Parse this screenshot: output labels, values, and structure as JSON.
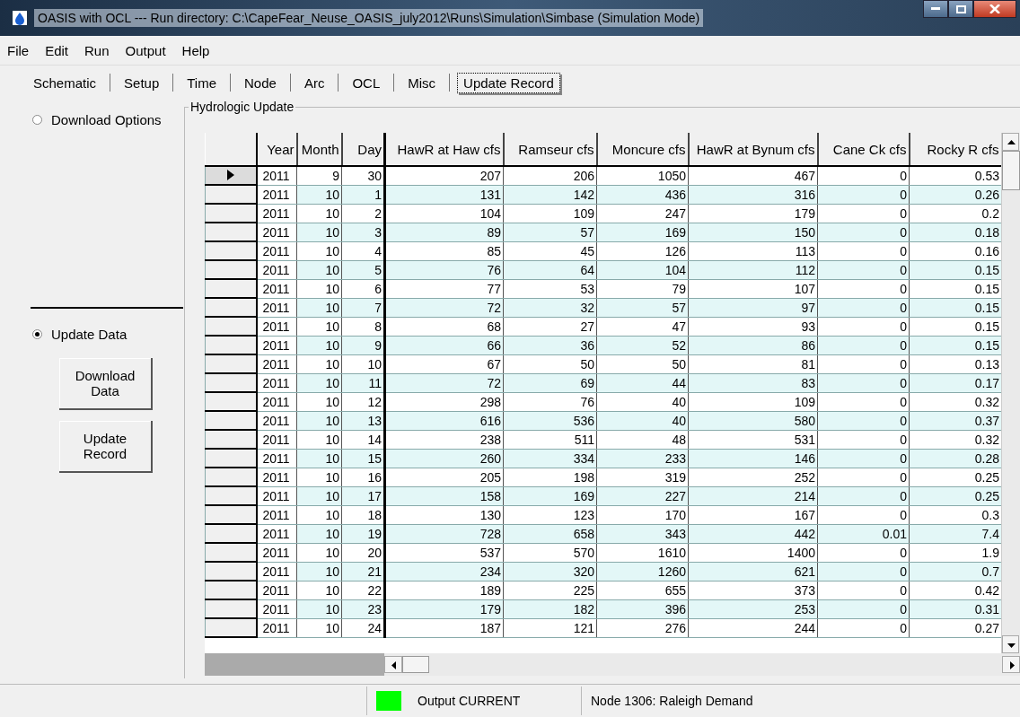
{
  "window": {
    "title": "OASIS with OCL --- Run directory: C:\\CapeFear_Neuse_OASIS_july2012\\Runs\\Simulation\\Simbase     (Simulation Mode)"
  },
  "menu": [
    "File",
    "Edit",
    "Run",
    "Output",
    "Help"
  ],
  "tabs": [
    {
      "label": "Schematic",
      "selected": false
    },
    {
      "label": "Setup",
      "selected": false
    },
    {
      "label": "Time",
      "selected": false
    },
    {
      "label": "Node",
      "selected": false
    },
    {
      "label": "Arc",
      "selected": false
    },
    {
      "label": "OCL",
      "selected": false
    },
    {
      "label": "Misc",
      "selected": false
    },
    {
      "label": "Update Record",
      "selected": true
    }
  ],
  "options": [
    {
      "label": "Download Options",
      "selected": false
    },
    {
      "label": "Update Data",
      "selected": true
    }
  ],
  "buttons": [
    "Download Data",
    "Update Record"
  ],
  "group_title": "Hydrologic Update",
  "table": {
    "columns": [
      "Year",
      "Month",
      "Day",
      "HawR at Haw cfs",
      "Ramseur cfs",
      "Moncure cfs",
      "HawR at Bynum cfs",
      "Cane Ck cfs",
      "Rocky R cfs"
    ],
    "rows": [
      {
        "selected": true,
        "cells": [
          "2011",
          "9",
          "30",
          "207",
          "206",
          "1050",
          "467",
          "0",
          "0.53"
        ]
      },
      {
        "selected": false,
        "cells": [
          "2011",
          "10",
          "1",
          "131",
          "142",
          "436",
          "316",
          "0",
          "0.26"
        ]
      },
      {
        "selected": false,
        "cells": [
          "2011",
          "10",
          "2",
          "104",
          "109",
          "247",
          "179",
          "0",
          "0.2"
        ]
      },
      {
        "selected": false,
        "cells": [
          "2011",
          "10",
          "3",
          "89",
          "57",
          "169",
          "150",
          "0",
          "0.18"
        ]
      },
      {
        "selected": false,
        "cells": [
          "2011",
          "10",
          "4",
          "85",
          "45",
          "126",
          "113",
          "0",
          "0.16"
        ]
      },
      {
        "selected": false,
        "cells": [
          "2011",
          "10",
          "5",
          "76",
          "64",
          "104",
          "112",
          "0",
          "0.15"
        ]
      },
      {
        "selected": false,
        "cells": [
          "2011",
          "10",
          "6",
          "77",
          "53",
          "79",
          "107",
          "0",
          "0.15"
        ]
      },
      {
        "selected": false,
        "cells": [
          "2011",
          "10",
          "7",
          "72",
          "32",
          "57",
          "97",
          "0",
          "0.15"
        ]
      },
      {
        "selected": false,
        "cells": [
          "2011",
          "10",
          "8",
          "68",
          "27",
          "47",
          "93",
          "0",
          "0.15"
        ]
      },
      {
        "selected": false,
        "cells": [
          "2011",
          "10",
          "9",
          "66",
          "36",
          "52",
          "86",
          "0",
          "0.15"
        ]
      },
      {
        "selected": false,
        "cells": [
          "2011",
          "10",
          "10",
          "67",
          "50",
          "50",
          "81",
          "0",
          "0.13"
        ]
      },
      {
        "selected": false,
        "cells": [
          "2011",
          "10",
          "11",
          "72",
          "69",
          "44",
          "83",
          "0",
          "0.17"
        ]
      },
      {
        "selected": false,
        "cells": [
          "2011",
          "10",
          "12",
          "298",
          "76",
          "40",
          "109",
          "0",
          "0.32"
        ]
      },
      {
        "selected": false,
        "cells": [
          "2011",
          "10",
          "13",
          "616",
          "536",
          "40",
          "580",
          "0",
          "0.37"
        ]
      },
      {
        "selected": false,
        "cells": [
          "2011",
          "10",
          "14",
          "238",
          "511",
          "48",
          "531",
          "0",
          "0.32"
        ]
      },
      {
        "selected": false,
        "cells": [
          "2011",
          "10",
          "15",
          "260",
          "334",
          "233",
          "146",
          "0",
          "0.28"
        ]
      },
      {
        "selected": false,
        "cells": [
          "2011",
          "10",
          "16",
          "205",
          "198",
          "319",
          "252",
          "0",
          "0.25"
        ]
      },
      {
        "selected": false,
        "cells": [
          "2011",
          "10",
          "17",
          "158",
          "169",
          "227",
          "214",
          "0",
          "0.25"
        ]
      },
      {
        "selected": false,
        "cells": [
          "2011",
          "10",
          "18",
          "130",
          "123",
          "170",
          "167",
          "0",
          "0.3"
        ]
      },
      {
        "selected": false,
        "cells": [
          "2011",
          "10",
          "19",
          "728",
          "658",
          "343",
          "442",
          "0.01",
          "7.4"
        ]
      },
      {
        "selected": false,
        "cells": [
          "2011",
          "10",
          "20",
          "537",
          "570",
          "1610",
          "1400",
          "0",
          "1.9"
        ]
      },
      {
        "selected": false,
        "cells": [
          "2011",
          "10",
          "21",
          "234",
          "320",
          "1260",
          "621",
          "0",
          "0.7"
        ]
      },
      {
        "selected": false,
        "cells": [
          "2011",
          "10",
          "22",
          "189",
          "225",
          "655",
          "373",
          "0",
          "0.42"
        ]
      },
      {
        "selected": false,
        "cells": [
          "2011",
          "10",
          "23",
          "179",
          "182",
          "396",
          "253",
          "0",
          "0.31"
        ]
      },
      {
        "selected": false,
        "cells": [
          "2011",
          "10",
          "24",
          "187",
          "121",
          "276",
          "244",
          "0",
          "0.27"
        ]
      }
    ]
  },
  "status_bar": {
    "output_current": true,
    "output_status": "Output CURRENT",
    "node": "Node 1306:  Raleigh Demand"
  }
}
